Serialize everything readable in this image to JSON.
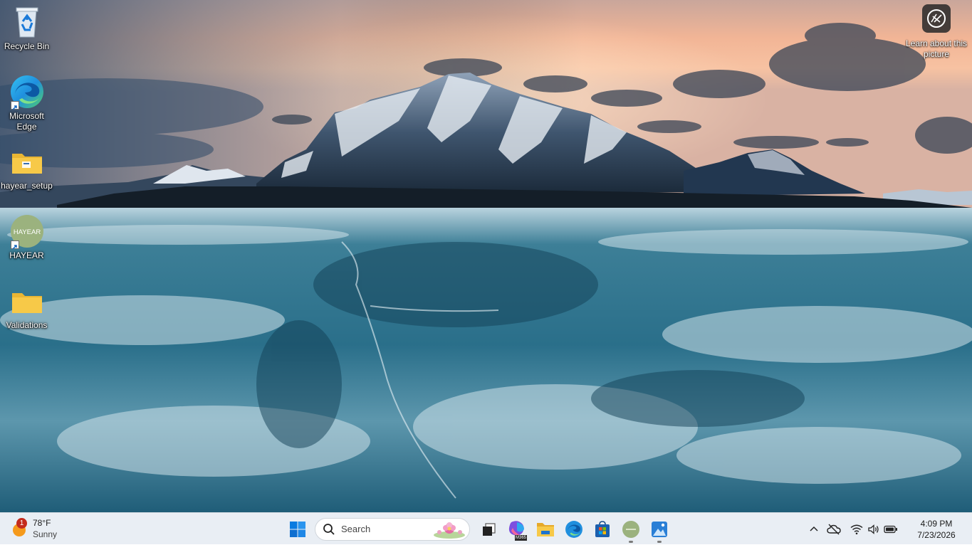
{
  "desktop": {
    "icons": [
      {
        "label": "Recycle Bin"
      },
      {
        "label": "Microsoft Edge"
      },
      {
        "label": "hayear_setup"
      },
      {
        "label": "HAYEAR"
      },
      {
        "label": "Validations"
      }
    ],
    "learn_about": {
      "label": "Learn about this picture"
    },
    "hayear_logo_text": "HAYEAR"
  },
  "taskbar": {
    "weather": {
      "temp": "78°F",
      "condition": "Sunny",
      "badge": "1"
    },
    "search": {
      "placeholder": "Search"
    },
    "apps": [
      {
        "icon": "windows-start-icon"
      },
      {
        "icon": "task-view-icon"
      },
      {
        "icon": "microsoft-365-copilot-icon",
        "badge": "M365"
      },
      {
        "icon": "file-explorer-icon"
      },
      {
        "icon": "edge-icon"
      },
      {
        "icon": "microsoft-store-icon"
      },
      {
        "icon": "hayear-app-icon"
      },
      {
        "icon": "photos-icon"
      }
    ],
    "tray": {
      "time": "4:09 PM",
      "date": "7/23/2026"
    }
  },
  "colors": {
    "taskbar_bg": "#e9eef4",
    "windows_blue": "#0a7be0",
    "folder_yellow": "#f7c948"
  }
}
